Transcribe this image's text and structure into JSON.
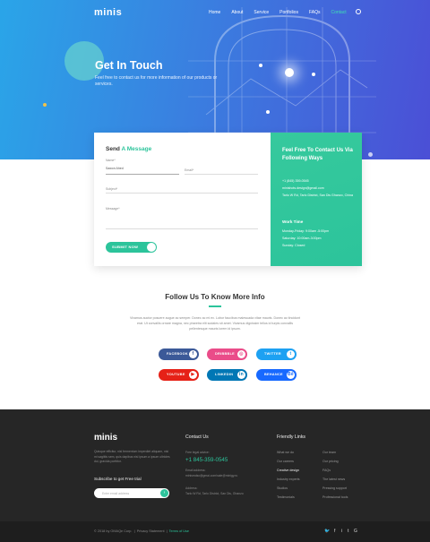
{
  "brand": "minis",
  "nav": {
    "items": [
      "Home",
      "About",
      "Service",
      "Portfolios",
      "FAQs",
      "Contact"
    ],
    "active": "Contact"
  },
  "hero": {
    "title": "Get In Touch",
    "subtitle": "Feel free to contact us for more information of our products or services."
  },
  "form": {
    "title_prefix": "Send ",
    "title_accent": "A Message",
    "name_label": "Name*",
    "name_value": "Sawon Ahed",
    "email_label": "Email*",
    "subject_label": "Subject*",
    "message_label": "Message*",
    "submit_label": "SUBMIT NOW"
  },
  "info": {
    "title": "Feel Free To Contact Us Via Following Ways",
    "phone": "+1 (845) 359-0545",
    "email": "minishots.design@gmail.com",
    "address": "Tarlo W Rd, Tarlo District, San Dis Ghanzo, China",
    "work_title": "Work Time",
    "hours_1": "Monday-Friday: 9:00am -5:00pm",
    "hours_2": "Saturday: 10:00am-3:00pm",
    "hours_3": "Sunday: Closed"
  },
  "follow": {
    "title": "Follow Us To Know More Info",
    "description": "Vivamus auctor posuere augue ac semper. Donec ac mi ex. Lobor faucibus malesuada vitae mauris. Donec ac tincidunt erat. Ut convallis ornare magna, nec pharetra elit sodales sit amet. Vivamus dignissim tellus id turpis convallis pellentesque mauris lorem id ipsum."
  },
  "socials": [
    {
      "label": "FACEBOOK",
      "icon": "f",
      "color": "#3b5998"
    },
    {
      "label": "DRIBBBLE",
      "icon": "◎",
      "color": "#ea4c89"
    },
    {
      "label": "TWITTER",
      "icon": "t",
      "color": "#1da1f2"
    },
    {
      "label": "YOUTUBE",
      "icon": "▶",
      "color": "#e62117"
    },
    {
      "label": "LINKEDIN",
      "icon": "in",
      "color": "#0077b5"
    },
    {
      "label": "BEHANCE",
      "icon": "Bē",
      "color": "#1769ff"
    }
  ],
  "footer": {
    "logo": "minis",
    "about": "Quisque efficitur, nisl fermentum imperdiet aliquam, nisi mi sagittis sem, quis dapibus nisl ipsum a ipsum ultricies dui, gravida porttitor.",
    "subscribe_title": "Subscribe to get Free trial",
    "email_placeholder": "Enter email address",
    "contact_title": "Contact Us",
    "phone_label": "Free legal advice:",
    "phone": "+1 845-359-0545",
    "email_label": "Email address:",
    "email": "minismdsc@gmai.com/sale@minigy.ru",
    "address_label": "Address:",
    "address": "Tarlo W Rd, Tarlo District, San Dis, Ghanzo",
    "links_title": "Friendly Links",
    "links_col1": [
      "What we do",
      "Our careers",
      "Creative design",
      "Industry experts",
      "Studios",
      "Testimonials"
    ],
    "links_col2": [
      "Our team",
      "Our pricing",
      "FAQs",
      "The latest news",
      "Pressing support",
      "Professional tools"
    ],
    "highlight_link": "Creative design"
  },
  "bottom": {
    "copyright": "© 2018 by OMAQe Corp.",
    "privacy": "Privacy Statement",
    "terms": "Terms of Use"
  },
  "colors": {
    "accent": "#2cc49b",
    "hero_start": "#2aa5e8",
    "hero_end": "#4b4fd6",
    "footer": "#262626"
  }
}
